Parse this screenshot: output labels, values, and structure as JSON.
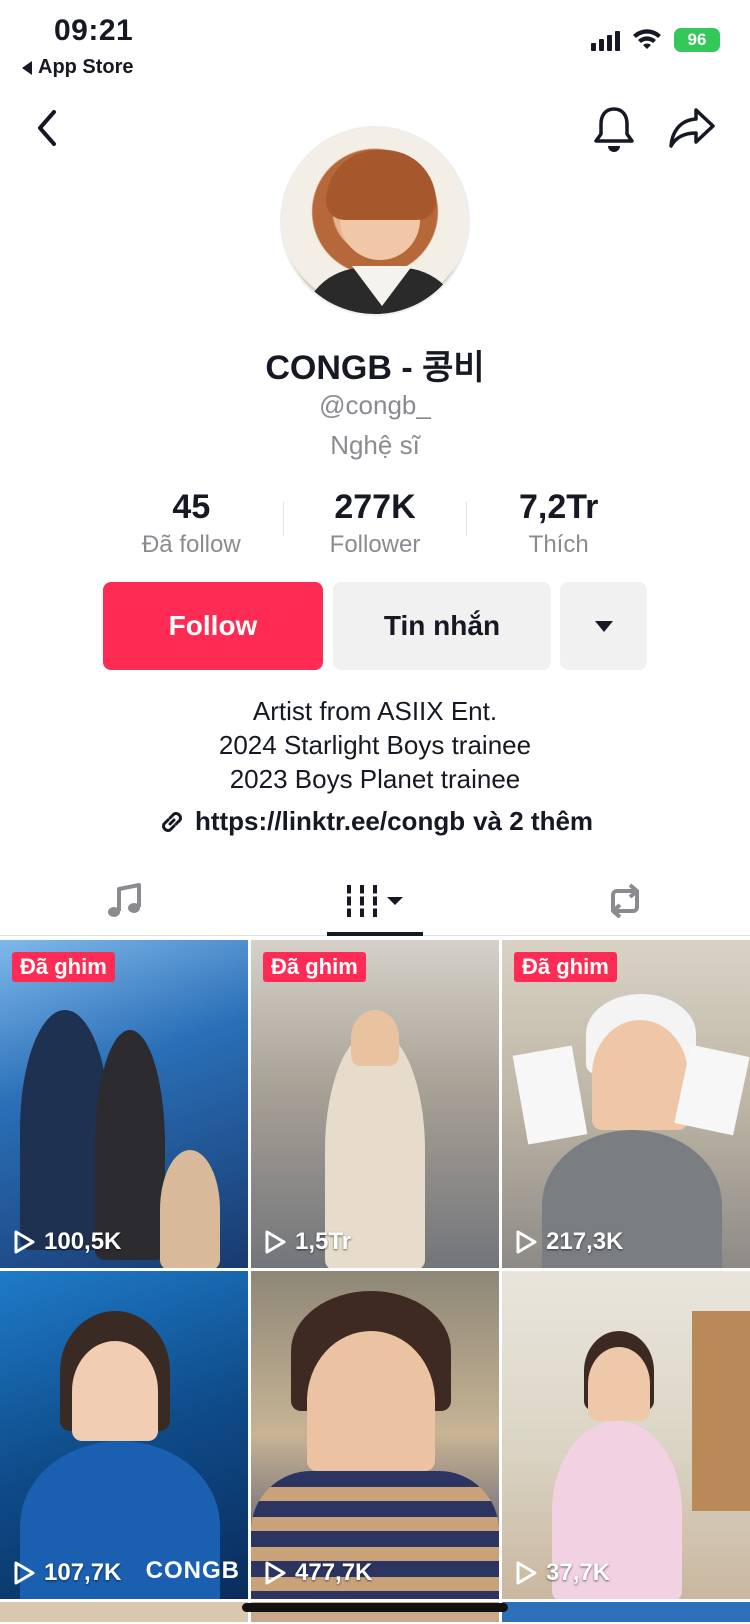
{
  "status_bar": {
    "time": "09:21",
    "back_app": "App Store",
    "battery": "96"
  },
  "profile": {
    "display_name": "CONGB - 콩비",
    "handle": "@congb_",
    "category": "Nghệ sĩ",
    "stats": [
      {
        "value": "45",
        "label": "Đã follow"
      },
      {
        "value": "277K",
        "label": "Follower"
      },
      {
        "value": "7,2Tr",
        "label": "Thích"
      }
    ],
    "buttons": {
      "follow": "Follow",
      "message": "Tin nhắn"
    },
    "bio": [
      "Artist from ASIIX Ent.",
      "2024 Starlight Boys trainee",
      "2023 Boys Planet trainee"
    ],
    "link": {
      "url": "https://linktr.ee/congb",
      "more": "và 2 thêm"
    }
  },
  "tabs": [
    {
      "icon": "music-icon"
    },
    {
      "icon": "videos-grid-icon"
    },
    {
      "icon": "repost-icon"
    }
  ],
  "videos": [
    {
      "pinned": "Đã ghim",
      "views": "100,5K"
    },
    {
      "pinned": "Đã ghim",
      "views": "1,5Tr"
    },
    {
      "pinned": "Đã ghim",
      "views": "217,3K"
    },
    {
      "views": "107,7K",
      "overlay_text": "CONGB"
    },
    {
      "views": "477,7K"
    },
    {
      "views": "37,7K"
    }
  ],
  "colors": {
    "accent": "#fe2c55",
    "text": "#161823",
    "muted": "#8a8b91",
    "button_bg": "#f1f1f2"
  }
}
